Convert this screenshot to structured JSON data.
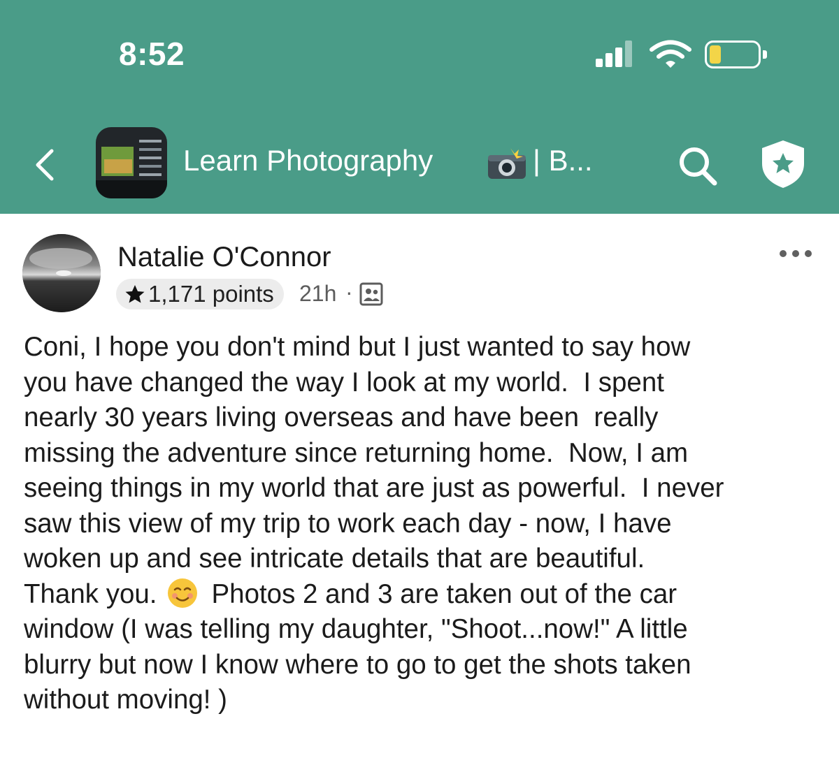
{
  "status_bar": {
    "time": "8:52",
    "icons": [
      "cellular-signal-icon",
      "wifi-icon",
      "battery-low-icon"
    ],
    "battery_color": "#f3d548"
  },
  "header": {
    "background_color": "#4a9c88",
    "back_icon": "chevron-left-icon",
    "group_name": "Learn Photography",
    "group_name_emoji": "camera-with-flash-icon",
    "group_name_tail": "| B...",
    "search_icon": "search-icon",
    "admin_icon": "shield-star-icon"
  },
  "post": {
    "author": "Natalie O'Connor",
    "points": "1,171 points",
    "time": "21h",
    "separator": "·",
    "audience_icon": "members-icon",
    "more_icon": "more-dots-icon",
    "body_lines": [
      "Coni, I hope you don't mind but I just wanted to say how",
      "you have changed the way I look at my world.  I spent",
      "nearly 30 years living overseas and have been  really",
      "missing the adventure since returning home.  Now, I am",
      "seeing things in my world that are just as powerful.  I never",
      "saw this view of my trip to work each day - now, I have",
      "woken up and see intricate details that are beautiful.",
      "Thank you.",
      "Photos 2 and 3 are taken out of the car",
      "window (I was telling my daughter, \"Shoot...now!\" A little",
      "blurry but now I know where to go to get the shots taken",
      "without moving! )"
    ],
    "inline_emoji": "smiling-face-icon"
  }
}
